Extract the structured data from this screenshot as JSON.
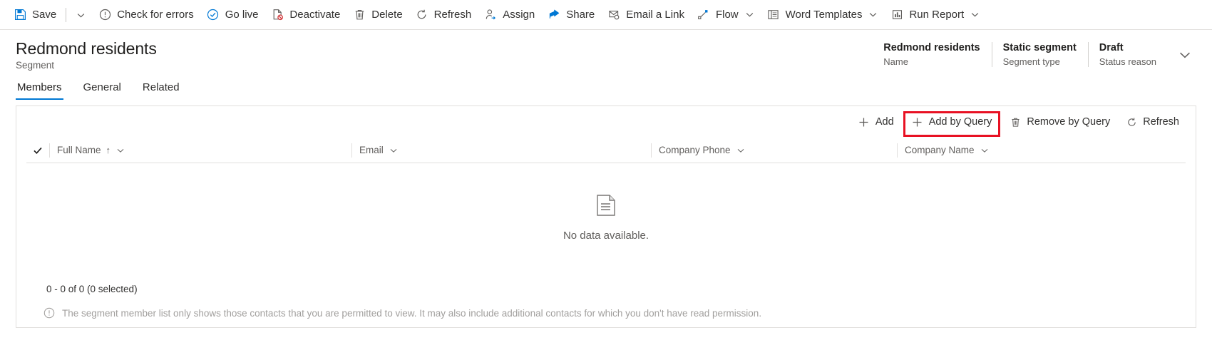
{
  "commandbar": {
    "items": [
      {
        "label": "Save",
        "icon": "save-icon"
      },
      {
        "label": "",
        "icon": "chevron-down-icon"
      },
      {
        "label": "Check for errors",
        "icon": "alert-circle-icon"
      },
      {
        "label": "Go live",
        "icon": "check-circle-icon"
      },
      {
        "label": "Deactivate",
        "icon": "deactivate-page-icon"
      },
      {
        "label": "Delete",
        "icon": "trash-icon"
      },
      {
        "label": "Refresh",
        "icon": "refresh-icon"
      },
      {
        "label": "Assign",
        "icon": "assign-person-icon"
      },
      {
        "label": "Share",
        "icon": "share-icon"
      },
      {
        "label": "Email a Link",
        "icon": "email-link-icon"
      },
      {
        "label": "Flow",
        "icon": "flow-icon"
      },
      {
        "label": "Word Templates",
        "icon": "word-template-icon"
      },
      {
        "label": "Run Report",
        "icon": "run-report-icon"
      }
    ]
  },
  "header": {
    "title": "Redmond residents",
    "subtitle": "Segment",
    "fields": [
      {
        "value": "Redmond residents",
        "label": "Name"
      },
      {
        "value": "Static segment",
        "label": "Segment type"
      },
      {
        "value": "Draft",
        "label": "Status reason"
      }
    ]
  },
  "tabs": [
    {
      "label": "Members",
      "active": true
    },
    {
      "label": "General",
      "active": false
    },
    {
      "label": "Related",
      "active": false
    }
  ],
  "grid": {
    "commands": [
      {
        "label": "Add",
        "icon": "plus-icon"
      },
      {
        "label": "Add by Query",
        "icon": "plus-icon"
      },
      {
        "label": "Remove by Query",
        "icon": "trash-icon"
      },
      {
        "label": "Refresh",
        "icon": "refresh-icon"
      }
    ],
    "highlight": {
      "target_label": "Add by Query",
      "color": "#e81123"
    },
    "columns": [
      {
        "label": "Full Name",
        "sorted": true,
        "sort_glyph": "↑"
      },
      {
        "label": "Email",
        "sorted": false,
        "sort_glyph": ""
      },
      {
        "label": "Company Phone",
        "sorted": false,
        "sort_glyph": ""
      },
      {
        "label": "Company Name",
        "sorted": false,
        "sort_glyph": ""
      }
    ],
    "rows": [],
    "empty_message": "No data available.",
    "empty_icon": "document-icon",
    "footer_count": "0 - 0 of 0 (0 selected)",
    "note_icon": "info-icon",
    "note": "The segment member list only shows those contacts that you are permitted to view. It may also include additional contacts for which you don't have read permission."
  }
}
